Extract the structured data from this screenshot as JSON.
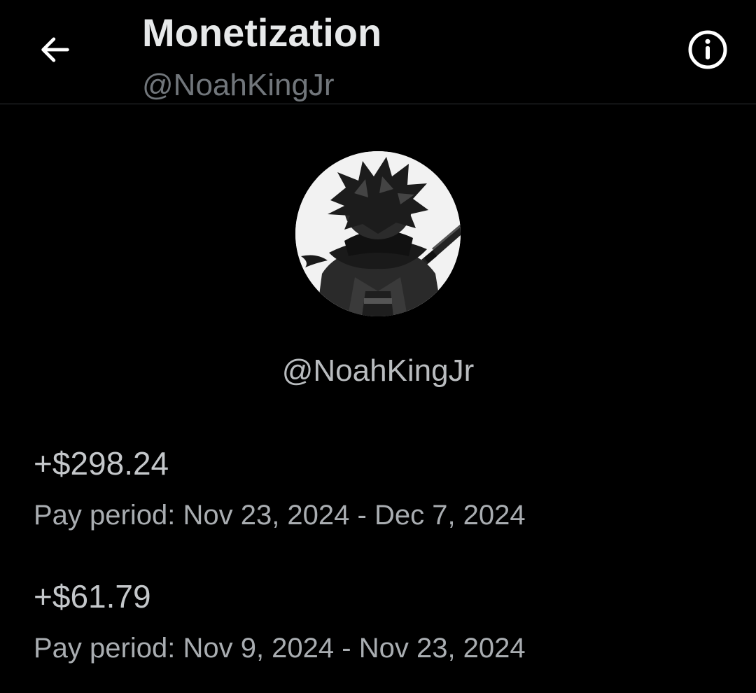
{
  "header": {
    "title": "Monetization",
    "subtitle": "@NoahKingJr",
    "back_icon": "arrow-left-icon",
    "info_icon": "info-circle-icon"
  },
  "profile": {
    "handle": "@NoahKingJr"
  },
  "payouts": [
    {
      "amount": "+$298.24",
      "period": "Pay period: Nov 23, 2024 - Dec 7, 2024"
    },
    {
      "amount": "+$61.79",
      "period": "Pay period: Nov 9, 2024 - Nov 23, 2024"
    }
  ],
  "colors": {
    "background": "#000000",
    "primary_text": "#e7e9ea",
    "secondary_text": "#71767b",
    "divider": "#2f3336"
  }
}
